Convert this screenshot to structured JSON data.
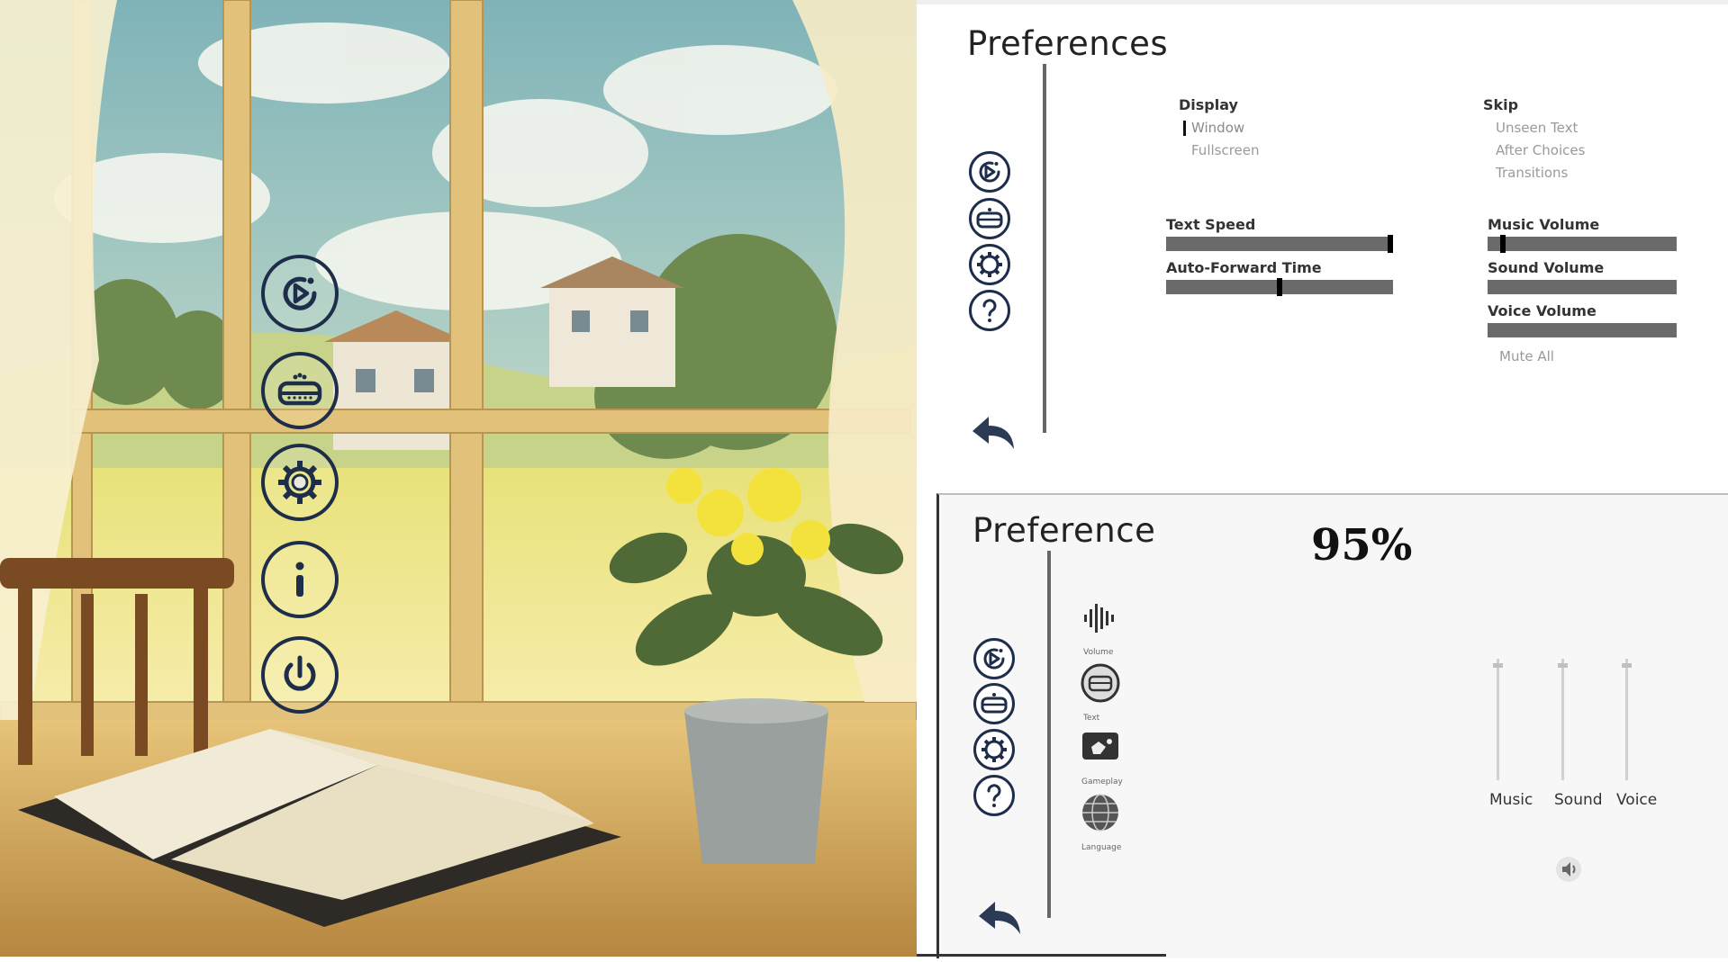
{
  "main_menu": {
    "items": [
      {
        "name": "play-button",
        "icon": "play-icon"
      },
      {
        "name": "save-load-button",
        "icon": "chest-icon"
      },
      {
        "name": "settings-button",
        "icon": "gear-icon"
      },
      {
        "name": "about-button",
        "icon": "info-icon"
      },
      {
        "name": "quit-button",
        "icon": "power-icon"
      }
    ]
  },
  "top_panel": {
    "title": "Preferences",
    "display": {
      "heading": "Display",
      "options": [
        "Window",
        "Fullscreen"
      ],
      "selected": "Window"
    },
    "skip": {
      "heading": "Skip",
      "options": [
        "Unseen Text",
        "After Choices",
        "Transitions"
      ]
    },
    "text_speed": {
      "label": "Text Speed",
      "value": 0.99
    },
    "auto_forward": {
      "label": "Auto-Forward Time",
      "value": 0.5
    },
    "music_volume": {
      "label": "Music Volume",
      "value": 0.08
    },
    "sound_volume": {
      "label": "Sound Volume"
    },
    "voice_volume": {
      "label": "Voice Volume"
    },
    "mute_all": "Mute All"
  },
  "bottom_panel": {
    "title": "Preference",
    "percent": "95%",
    "categories": [
      {
        "label": "Volume",
        "icon": "sound-wave-icon"
      },
      {
        "label": "Text",
        "icon": "chest-icon"
      },
      {
        "label": "Gameplay",
        "icon": "gamepad-icon"
      },
      {
        "label": "Language",
        "icon": "globe-icon"
      }
    ],
    "sliders": [
      {
        "label": "Music",
        "value": 0.95
      },
      {
        "label": "Sound",
        "value": 0.95
      },
      {
        "label": "Voice",
        "value": 0.95
      }
    ]
  },
  "colors": {
    "icon": "#1e2d4a",
    "bar": "#6a6a6a",
    "panel_bg": "#f7f7f7"
  }
}
